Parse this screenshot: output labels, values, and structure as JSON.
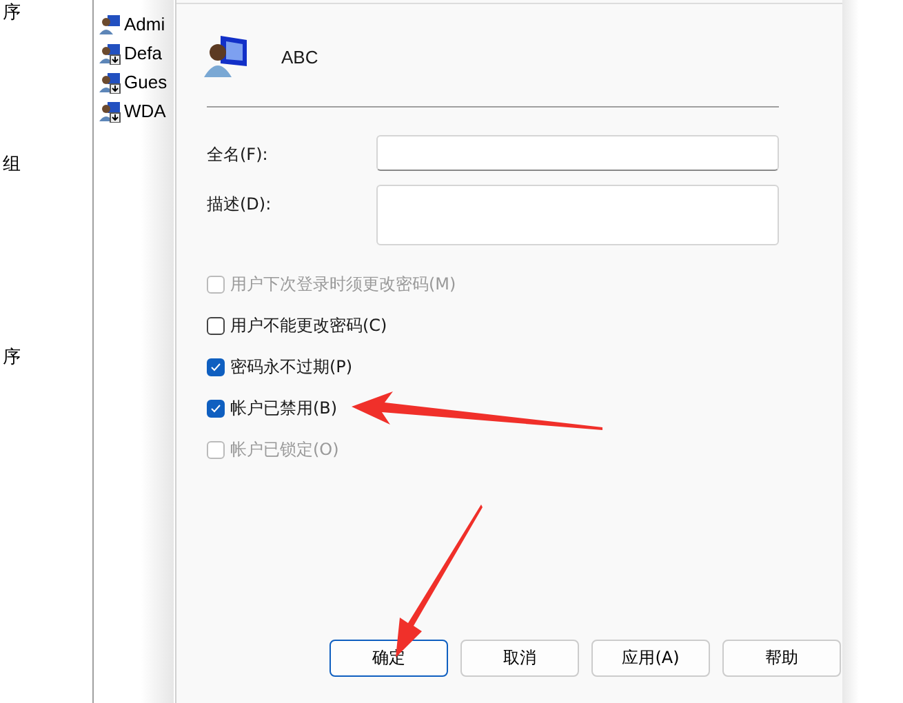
{
  "left_pane": {
    "items": [
      "序",
      "组",
      "序"
    ]
  },
  "user_list": {
    "items": [
      "Admi",
      "Defa",
      "Gues",
      "WDA"
    ]
  },
  "dialog": {
    "user_name": "ABC",
    "fields": [
      {
        "label": "全名(F):",
        "kind": "line"
      },
      {
        "label": "描述(D):",
        "kind": "box"
      }
    ],
    "checkboxes": [
      {
        "label": "用户下次登录时须更改密码(M)",
        "checked": false,
        "disabled": true
      },
      {
        "label": "用户不能更改密码(C)",
        "checked": false,
        "disabled": false
      },
      {
        "label": "密码永不过期(P)",
        "checked": true,
        "disabled": false
      },
      {
        "label": "帐户已禁用(B)",
        "checked": true,
        "disabled": false
      },
      {
        "label": "帐户已锁定(O)",
        "checked": false,
        "disabled": true
      }
    ],
    "buttons": [
      {
        "label": "确定",
        "default": true
      },
      {
        "label": "取消",
        "default": false
      },
      {
        "label": "应用(A)",
        "default": false
      },
      {
        "label": "帮助",
        "default": false
      }
    ]
  }
}
